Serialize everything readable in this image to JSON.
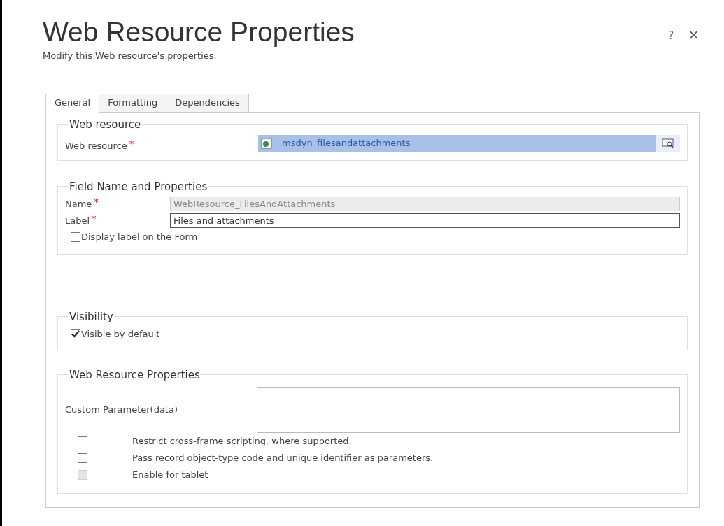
{
  "dialog": {
    "title": "Web Resource Properties",
    "subtitle": "Modify this Web resource's properties.",
    "help": "?",
    "close": "×"
  },
  "tabs": [
    {
      "label": "General",
      "selected": true
    },
    {
      "label": "Formatting",
      "selected": false
    },
    {
      "label": "Dependencies",
      "selected": false
    }
  ],
  "sections": [
    {
      "kind": "lookup",
      "legend": "Web resource",
      "label": "Web resource",
      "required_mark": "*",
      "value": "msdyn_filesandattachments"
    },
    {
      "kind": "fields",
      "legend": "Field Name and Properties",
      "rows": [
        {
          "label": "Name",
          "required_mark": "*",
          "value": "WebResource_FilesAndAttachments",
          "disabled": true
        },
        {
          "label": "Label",
          "required_mark": "*",
          "value": "Files and attachments",
          "disabled": false
        }
      ],
      "checkbox": {
        "label": "Display label on the Form",
        "checked": false
      }
    },
    {
      "kind": "checks",
      "legend": "Visibility",
      "checkboxes": [
        {
          "label": "Visible by default",
          "checked": true
        }
      ]
    },
    {
      "kind": "params",
      "legend": "Web Resource Properties",
      "param_label": "Custom Parameter(data)",
      "options": [
        {
          "label": "Restrict cross-frame scripting, where supported.",
          "checked": false,
          "disabled": false
        },
        {
          "label": "Pass record object-type code and unique identifier as parameters.",
          "checked": false,
          "disabled": false
        },
        {
          "label": "Enable for tablet",
          "checked": false,
          "disabled": true
        }
      ]
    }
  ]
}
